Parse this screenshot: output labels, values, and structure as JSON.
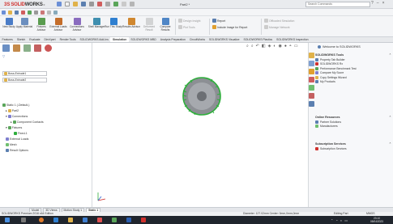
{
  "titlebar": {
    "brand_prefix": "3S",
    "brand_solid": "SOLID",
    "brand_works": "WORKS",
    "doc_title": "Part2 *",
    "search_placeholder": "Search Commands",
    "help": "?",
    "minimize": "–",
    "close": "×"
  },
  "ribbon": {
    "buttons": [
      {
        "label": "New Study",
        "color": "#4a7cc7"
      },
      {
        "label": "Apply Material",
        "color": "#6c8fbf"
      },
      {
        "label": "Fixtures Advisor",
        "color": "#5a9c4f"
      },
      {
        "label": "External Loads Advisor",
        "color": "#c46d2a"
      },
      {
        "label": "Connections Advisor",
        "color": "#8a6cbf"
      },
      {
        "label": "Shell Manager",
        "color": "#3f8fb0"
      },
      {
        "label": "Run This Study",
        "color": "#2f7fd0"
      },
      {
        "label": "Results Advisor",
        "color": "#d0872f"
      },
      {
        "label": "Deformed Result",
        "color": "#b8b8b8"
      },
      {
        "label": "Compare Results",
        "color": "#4f86c6"
      }
    ],
    "right_items": [
      "Design Insight",
      "Plot Tools",
      "Report",
      "Include Image for Report",
      "Offloaded Simulation",
      "Manage Network"
    ]
  },
  "tabs": [
    "Features",
    "Sketch",
    "Evaluate",
    "DimXpert",
    "Render Tools",
    "SOLIDWORKS Add-Ins",
    "Simulation",
    "SOLIDWORKS MBD",
    "Analysis Preparation",
    "CircuitWorks",
    "SOLIDWORKS Visualize",
    "SOLIDWORKS Plastics",
    "SOLIDWORKS Inspection"
  ],
  "tree": {
    "combo1": "Boss-Extrude1",
    "combo2": "Boss-Extrude2",
    "study": "Static 1 (-Default-)",
    "part": "Part2",
    "connections": "Connections",
    "component_contacts": "Component Contacts",
    "fixtures": "Fixtures",
    "fixed": "Fixed-1",
    "external_loads": "External Loads",
    "mesh": "Mesh",
    "result_options": "Result Options"
  },
  "task_pane": {
    "welcome": "Welcome to SOLIDWORKS",
    "tools_header": "SOLIDWORKS Tools",
    "tools": [
      "Property Tab Builder",
      "SOLIDWORKS Rx",
      "Performance Benchmark Test",
      "Compare My Score",
      "Copy Settings Wizard",
      "My Products"
    ],
    "online_header": "Online Resources",
    "online": [
      "Partner Solutions",
      "Manufacturers"
    ],
    "subs_header": "Subscription Services",
    "subs": [
      "Subscription Services"
    ]
  },
  "bottom_tabs": [
    "Model",
    "3D Views",
    "Motion Study 1",
    "Static 1"
  ],
  "status": {
    "left": "SOLIDWORKS Premium 2016 x64 Edition",
    "diameter": "Diameter: 127.02mm  Center: 0mm,0mm,0mm",
    "editing": "Editing Part",
    "units": "MMGS"
  },
  "clock": {
    "time": "23:10",
    "date": "05/04/2023"
  },
  "colors": {
    "accent": "#d0312d",
    "simulation_green": "#2fae3c",
    "taskbar": "#20252d"
  }
}
